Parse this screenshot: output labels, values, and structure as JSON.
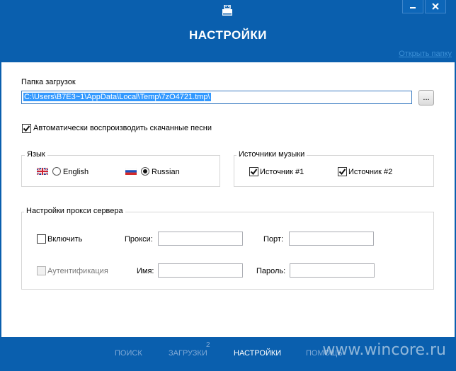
{
  "header": {
    "title": "НАСТРОЙКИ",
    "open_folder_link": "Открыть папку"
  },
  "downloads": {
    "label": "Папка загрузок",
    "path_value": "C:\\Users\\B7E3~1\\AppData\\Local\\Temp\\7zO4721.tmp\\",
    "browse_label": "..."
  },
  "autoplay": {
    "label": "Автоматически воспроизводить скачанные песни",
    "checked": true
  },
  "language": {
    "legend": "Язык",
    "english_label": "English",
    "russian_label": "Russian",
    "selected": "Russian"
  },
  "sources": {
    "legend": "Источники музыки",
    "source1_label": "Источник #1",
    "source2_label": "Источник #2"
  },
  "proxy": {
    "legend": "Настройки прокси сервера",
    "enable_label": "Включить",
    "proxy_label": "Прокси:",
    "port_label": "Порт:",
    "auth_label": "Аутентификация",
    "name_label": "Имя:",
    "password_label": "Пароль:"
  },
  "footer": {
    "nav_search": "ПОИСК",
    "nav_downloads": "ЗАГРУЗКИ",
    "downloads_count": "2",
    "nav_settings": "НАСТРОЙКИ",
    "nav_help": "ПОМОЩЬ",
    "watermark": "www.wincore.ru"
  },
  "colors": {
    "brand_blue": "#0a5fae",
    "link_blue": "#3b8fd6",
    "selection_blue": "#3399ff"
  }
}
